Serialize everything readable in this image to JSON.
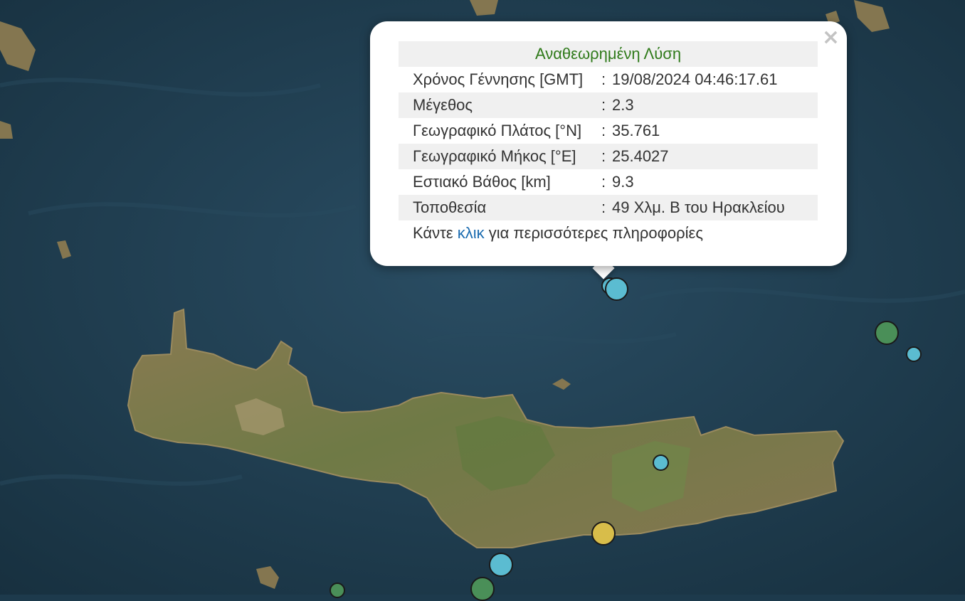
{
  "popup": {
    "title": "Αναθεωρημένη Λύση",
    "close_symbol": "×",
    "rows": [
      {
        "label": "Χρόνος Γέννησης [GMT]",
        "sep": ":",
        "value": "19/08/2024 04:46:17.61"
      },
      {
        "label": "Μέγεθος",
        "sep": ":",
        "value": "2.3"
      },
      {
        "label": "Γεωγραφικό Πλάτος [°N]",
        "sep": ":",
        "value": "35.761"
      },
      {
        "label": "Γεωγραφικό Μήκος [°E]",
        "sep": ":",
        "value": "25.4027"
      },
      {
        "label": "Εστιακό Βάθος [km]",
        "sep": ":",
        "value": "9.3"
      },
      {
        "label": "Τοποθεσία",
        "sep": ":",
        "value": "49 Χλμ. Β του Ηρακλείου"
      }
    ],
    "footer_prefix": "Κάντε",
    "footer_link": "κλικ",
    "footer_suffix": "για περισσότερες πληροφορίες"
  },
  "colors": {
    "sea": "#1d3a4c",
    "title_green": "#2f7a1a",
    "link_blue": "#1a6bb0",
    "marker_cyan": "#5bbcd1",
    "marker_green": "#4a8f58",
    "marker_yellow": "#d8bd4a"
  },
  "markers": [
    {
      "name": "earthquake-marker-selected",
      "color": "marker_cyan"
    },
    {
      "name": "earthquake-marker-selected-2",
      "color": "marker_cyan"
    },
    {
      "name": "earthquake-marker-east-green",
      "color": "marker_green"
    },
    {
      "name": "earthquake-marker-east-cyan",
      "color": "marker_cyan"
    },
    {
      "name": "earthquake-marker-crete-inland",
      "color": "marker_cyan"
    },
    {
      "name": "earthquake-marker-south-yellow",
      "color": "marker_yellow"
    },
    {
      "name": "earthquake-marker-south-cyan",
      "color": "marker_cyan"
    },
    {
      "name": "earthquake-marker-south-green",
      "color": "marker_green"
    },
    {
      "name": "earthquake-marker-southwest-green",
      "color": "marker_green"
    }
  ]
}
